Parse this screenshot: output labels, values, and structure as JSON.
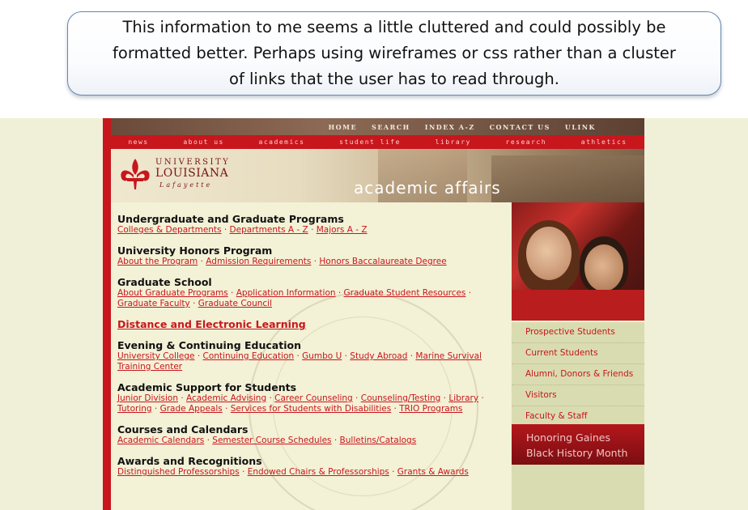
{
  "callout": {
    "line1": "This information to me seems a little cluttered and could possibly be",
    "line2": "formatted better.  Perhaps using wireframes or css rather than a cluster",
    "line3": "of links that the user has to read through."
  },
  "top_nav": [
    "HOME",
    "SEARCH",
    "INDEX A-Z",
    "CONTACT US",
    "ULINK"
  ],
  "main_nav": [
    "news",
    "about us",
    "academics",
    "student life",
    "library",
    "research",
    "athletics"
  ],
  "logo": {
    "line1": "UNIVERSITY",
    "line2": "LOUISIANA",
    "line3": "Lafayette"
  },
  "banner_title": "academic affairs",
  "sections": [
    {
      "title": "Undergraduate and Graduate Programs",
      "links": [
        "Colleges & Departments",
        "Departments A - Z",
        "Majors A - Z"
      ]
    },
    {
      "title": "University Honors Program",
      "links": [
        "About the Program",
        "Admission Requirements",
        "Honors Baccalaureate Degree"
      ]
    },
    {
      "title": "Graduate School",
      "links": [
        "About Graduate Programs",
        "Application Information",
        "Graduate Student Resources",
        "Graduate Faculty",
        "Graduate Council"
      ]
    },
    {
      "title": "Distance and Electronic Learning",
      "links": []
    },
    {
      "title": "Evening & Continuing Education",
      "links": [
        "University College",
        "Continuing Education",
        "Gumbo U",
        "Study Abroad",
        "Marine Survival Training Center"
      ]
    },
    {
      "title": "Academic Support for Students",
      "links": [
        "Junior Division",
        "Academic Advising",
        "Career Counseling",
        "Counseling/Testing",
        "Library",
        "Tutoring",
        "Grade Appeals",
        "Services for Students with Disabilities",
        "TRIO Programs"
      ]
    },
    {
      "title": "Courses and Calendars",
      "links": [
        "Academic Calendars",
        "Semester Course Schedules",
        "Bulletins/Catalogs"
      ]
    },
    {
      "title": "Awards and Recognitions",
      "links": [
        "Distinguished Professorships",
        "Endowed Chairs & Professorships",
        "Grants & Awards"
      ]
    }
  ],
  "side_menu": [
    "Prospective Students",
    "Current Students",
    "Alumni, Donors & Friends",
    "Visitors",
    "Faculty & Staff"
  ],
  "promo": {
    "line1": "Honoring Gaines",
    "line2": "Black History Month"
  },
  "colors": {
    "brand_red": "#c8161d",
    "page_bg": "#f3f1d6",
    "side_bg": "#d9dcb0"
  }
}
